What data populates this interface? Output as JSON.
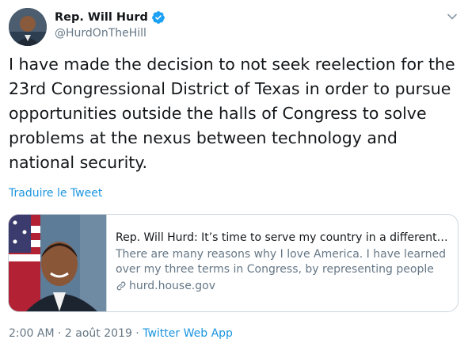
{
  "author": {
    "display_name": "Rep. Will Hurd",
    "handle": "@HurdOnTheHill",
    "verified": true
  },
  "tweet": {
    "text": "I have made the decision to not seek reelection for the 23rd Congressional District of Texas in order to pursue opportunities outside the halls of Congress to solve problems at the nexus between technology and national security.",
    "translate_label": "Traduire le Tweet"
  },
  "card": {
    "title": "Rep. Will Hurd: It’s time to serve my country in a different way",
    "description": "There are many reasons why I love America. I have learned over my three terms in Congress, by representing people that vote...",
    "domain": "hurd.house.gov"
  },
  "meta": {
    "time": "2:00 AM",
    "separator1": " · ",
    "date": "2 août 2019",
    "separator2": " · ",
    "source": "Twitter Web App"
  },
  "icons": {
    "verified": "verified-badge",
    "menu": "chevron-down",
    "link": "link"
  },
  "colors": {
    "accent": "#1b95e0",
    "text": "#14171a",
    "secondary": "#657786",
    "border": "#ccd6dd"
  }
}
